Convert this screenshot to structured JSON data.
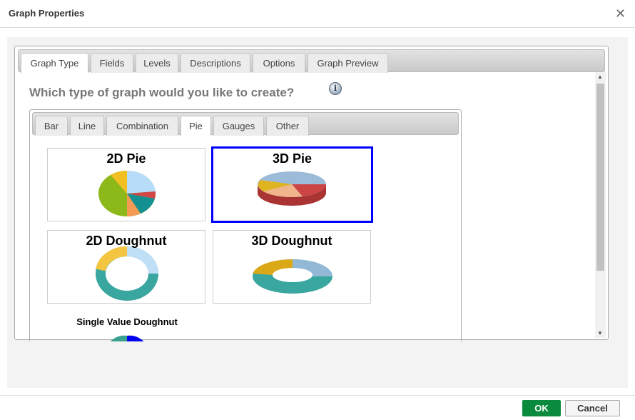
{
  "dialog": {
    "title": "Graph Properties",
    "close_icon": "close-icon"
  },
  "tabs": [
    "Graph Type",
    "Fields",
    "Levels",
    "Descriptions",
    "Options",
    "Graph Preview"
  ],
  "active_tab": "Graph Type",
  "question": "Which type of graph would you like to create?",
  "info_icon": "i",
  "graph_tabs": [
    "Bar",
    "Line",
    "Combination",
    "Pie",
    "Gauges",
    "Other"
  ],
  "active_graph_tab": "Pie",
  "options": [
    {
      "title": "2D Pie",
      "selected": false
    },
    {
      "title": "3D Pie",
      "selected": true
    },
    {
      "title": "2D Doughnut",
      "selected": false
    },
    {
      "title": "3D Doughnut",
      "selected": false
    },
    {
      "title": "Single Value Doughnut",
      "selected": false
    }
  ],
  "selection_color": "#0000ff",
  "footer": {
    "ok": "OK",
    "cancel": "Cancel"
  },
  "ok_color": "#0a8a3c"
}
